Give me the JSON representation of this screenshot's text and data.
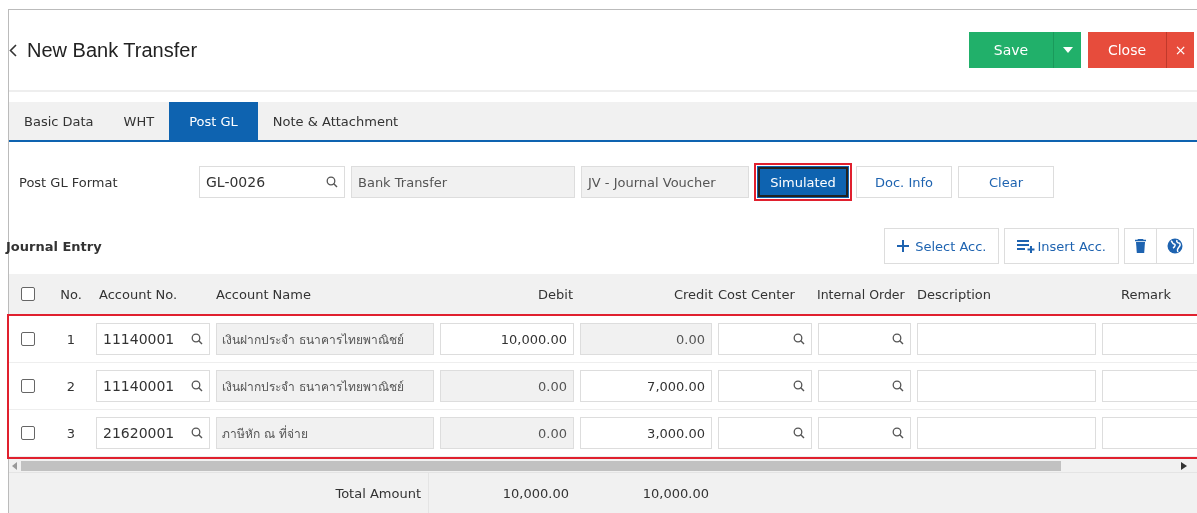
{
  "header": {
    "title": "New Bank Transfer",
    "buttons": [
      {
        "label": "Save",
        "kind": "save"
      },
      {
        "label": "Close",
        "kind": "close"
      }
    ],
    "close_glyph": "×"
  },
  "tabs": [
    {
      "label": "Basic Data",
      "selected": false
    },
    {
      "label": "WHT",
      "selected": false
    },
    {
      "label": "Post GL",
      "selected": true
    },
    {
      "label": "Note & Attachment",
      "selected": false
    }
  ],
  "post_gl": {
    "label": "Post GL Format",
    "code": "GL-0026",
    "name": "Bank Transfer",
    "journal": "JV - Journal Voucher",
    "buttons": [
      {
        "label": "Simulated",
        "primary": true,
        "highlighted": true
      },
      {
        "label": "Doc. Info",
        "primary": false,
        "highlighted": false
      },
      {
        "label": "Clear",
        "primary": false,
        "highlighted": false
      }
    ]
  },
  "journal": {
    "title": "Journal Entry",
    "actions": [
      {
        "label": "Select Acc.",
        "kind": "select"
      },
      {
        "label": "Insert Acc.",
        "kind": "insert"
      },
      {
        "kind": "delete"
      },
      {
        "kind": "globe"
      }
    ]
  },
  "table": {
    "highlighted": true,
    "all_checked": false,
    "columns": [
      "No.",
      "Account No.",
      "Account Name",
      "Debit",
      "Credit",
      "Cost Center",
      "Internal Order",
      "Description",
      "Remark"
    ],
    "rows": [
      {
        "checked": false,
        "no": "1",
        "account_no": "11140001",
        "account_name": "เงินฝากประจำ ธนาคารไทยพาณิชย์",
        "debit": {
          "value": "10,000.00",
          "disabled": false
        },
        "credit": {
          "value": "0.00",
          "disabled": true
        }
      },
      {
        "checked": false,
        "no": "2",
        "account_no": "11140001",
        "account_name": "เงินฝากประจำ ธนาคารไทยพาณิชย์",
        "debit": {
          "value": "0.00",
          "disabled": true
        },
        "credit": {
          "value": "7,000.00",
          "disabled": false
        }
      },
      {
        "checked": false,
        "no": "3",
        "account_no": "21620001",
        "account_name": "ภาษีหัก ณ ที่จ่าย",
        "debit": {
          "value": "0.00",
          "disabled": true
        },
        "credit": {
          "value": "3,000.00",
          "disabled": false
        }
      }
    ],
    "total": {
      "label": "Total Amount",
      "debit": "10,000.00",
      "credit": "10,000.00"
    }
  }
}
